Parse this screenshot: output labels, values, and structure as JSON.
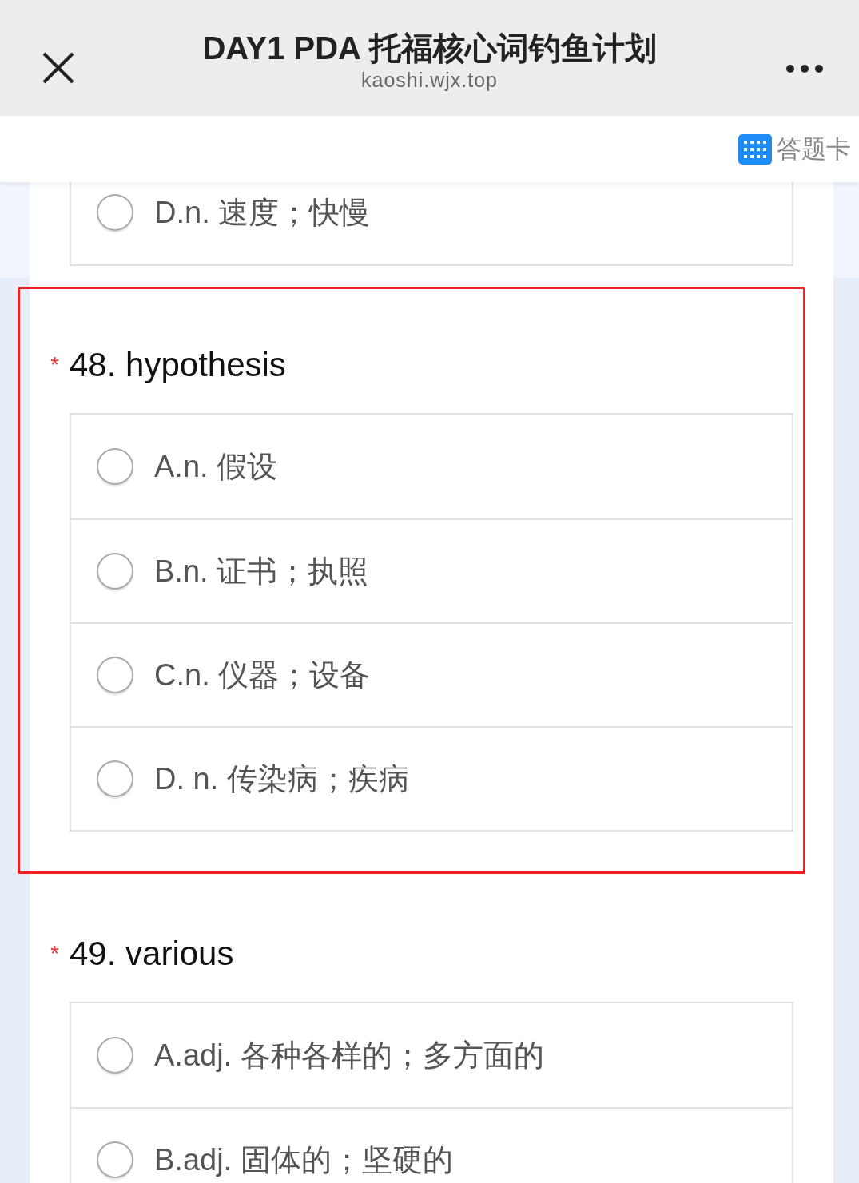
{
  "header": {
    "title": "DAY1 PDA 托福核心词钓鱼计划",
    "subtitle": "kaoshi.wjx.top"
  },
  "toolbar": {
    "answer_card": "答题卡"
  },
  "previous_options": [
    {
      "label": "D.n. 速度；快慢",
      "selected": false
    }
  ],
  "questions": [
    {
      "required_mark": "*",
      "highlighted": true,
      "title": "48. hypothesis",
      "options": [
        {
          "label": "A.n. 假设",
          "selected": false
        },
        {
          "label": "B.n. 证书；执照",
          "selected": false
        },
        {
          "label": "C.n. 仪器；设备",
          "selected": false
        },
        {
          "label": "D. n. 传染病；疾病",
          "selected": false
        }
      ]
    },
    {
      "required_mark": "*",
      "highlighted": false,
      "title": "49. various",
      "options": [
        {
          "label": "A.adj. 各种各样的；多方面的",
          "selected": false
        },
        {
          "label": "B.adj. 固体的；坚硬的",
          "selected": false
        }
      ]
    }
  ]
}
